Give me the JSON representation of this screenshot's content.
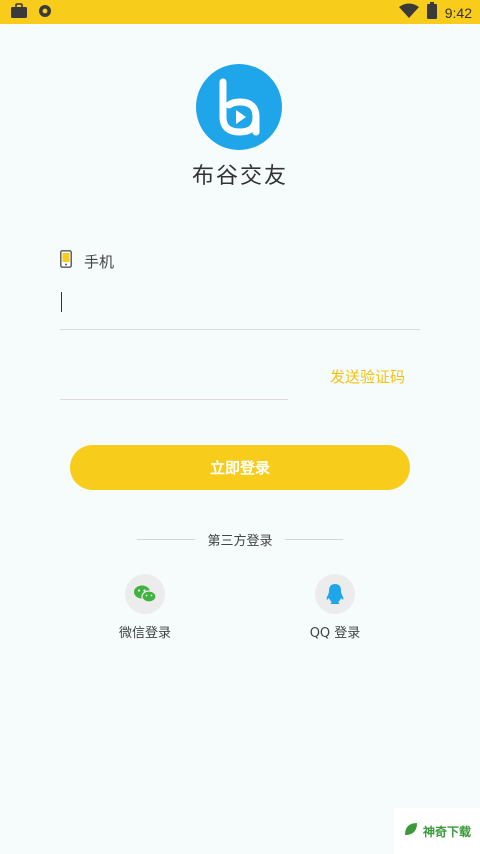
{
  "status_bar": {
    "time": "9:42",
    "icons": [
      "briefcase-icon",
      "shield-icon",
      "wifi-icon",
      "battery-icon"
    ],
    "color": "#f8cc1a"
  },
  "app": {
    "name": "布谷交友",
    "logo_color": "#1fa6ea"
  },
  "form": {
    "phone_label": "手机",
    "phone_value": "",
    "code_value": "",
    "send_code_label": "发送验证码",
    "login_label": "立即登录"
  },
  "third_party": {
    "title": "第三方登录",
    "wechat_label": "微信登录",
    "qq_label": "QQ 登录"
  },
  "watermark": {
    "text": "神奇下载"
  },
  "colors": {
    "accent": "#f8cc1a",
    "send_code": "#f5c214",
    "wechat": "#3fb23f",
    "qq": "#1fa6ea"
  }
}
